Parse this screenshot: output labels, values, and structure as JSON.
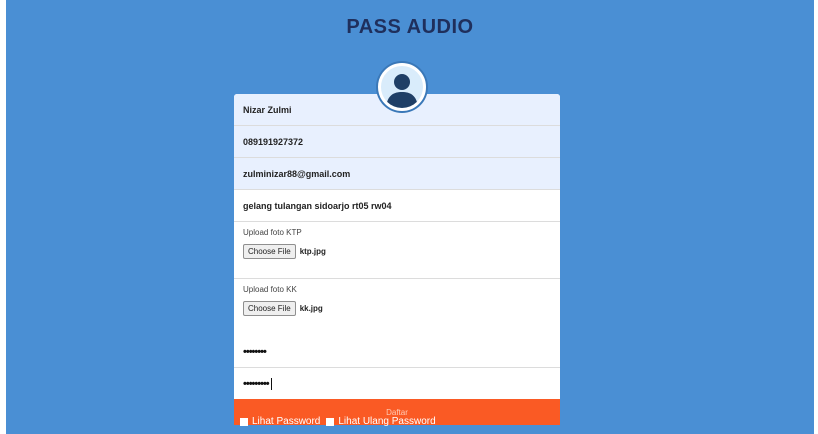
{
  "page": {
    "title": "PASS AUDIO"
  },
  "form": {
    "name_value": "Nizar Zulmi",
    "phone_value": "089191927372",
    "email_value": "zulminizar88@gmail.com",
    "address_value": "gelang tulangan sidoarjo rt05 rw04",
    "ktp": {
      "label": "Upload foto KTP",
      "button_label": "Choose File",
      "filename": "ktp.jpg"
    },
    "kk": {
      "label": "Upload foto KK",
      "button_label": "Choose File",
      "filename": "kk.jpg"
    },
    "password_masked": "••••••••",
    "confirm_password_masked": "•••••••••",
    "submit_label": "Daftar"
  },
  "options": {
    "show_password_label": "Lihat Password",
    "show_confirm_password_label": "Lihat Ulang Password"
  },
  "colors": {
    "background": "#4a8fd4",
    "submit_button": "#fa5a24",
    "autofill_field": "#e8f0fe",
    "title_text": "#1f2f5c"
  },
  "icons": {
    "avatar": "user-avatar-icon"
  }
}
